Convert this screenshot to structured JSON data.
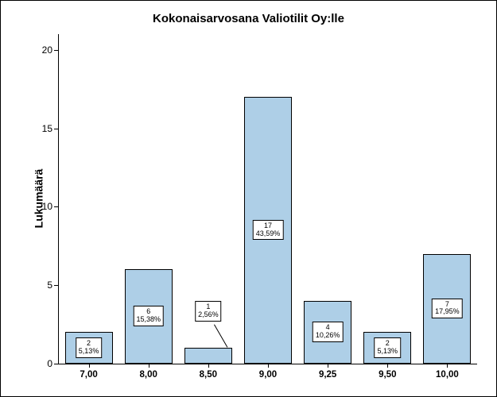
{
  "chart_data": {
    "type": "bar",
    "title": "Kokonaisarvosana Valiotilit Oy:lle",
    "ylabel": "Lukumäärä",
    "xlabel": "",
    "categories": [
      "7,00",
      "8,00",
      "8,50",
      "9,00",
      "9,25",
      "9,50",
      "10,00"
    ],
    "values": [
      2,
      6,
      1,
      17,
      4,
      2,
      7
    ],
    "percent_labels": [
      "5,13%",
      "15,38%",
      "2,56%",
      "43,59%",
      "10,26%",
      "5,13%",
      "17,95%"
    ],
    "yticks": [
      0,
      5,
      10,
      15,
      20
    ],
    "ylim": [
      0,
      21
    ]
  }
}
